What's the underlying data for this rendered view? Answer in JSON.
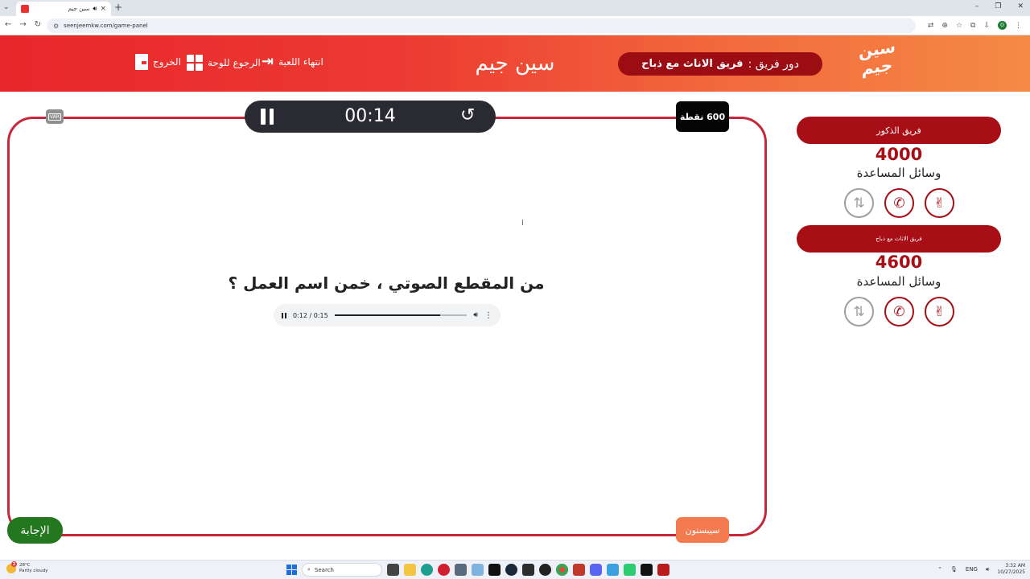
{
  "browser": {
    "tab_title": "سين جيم",
    "tab_audio_icon": "speaker-icon",
    "url": "seenjeemkw.com/game-panel"
  },
  "header": {
    "logo_text_line1": "سين",
    "logo_text_line2": "جيم",
    "turn_label": "دور فريق :",
    "turn_team": "فريق الاناث مع ذباح",
    "title": "سين جيم",
    "end_game": "انتهاء اللعبة",
    "back_to_board": "الرجوع للوحة",
    "exit": "الخروج"
  },
  "board": {
    "var_label": "VAR",
    "timer": "00:14",
    "points": "600 نقطة",
    "question": "من المقطع الصوتي ، خمن اسم العمل ؟",
    "audio": {
      "time": "0:12 / 0:15",
      "progress": 0.8
    },
    "answer_button": "الإجابة",
    "category_button": "سيبستون"
  },
  "teams": [
    {
      "name": "فريق الذكور",
      "score": "4000",
      "aids_label": "وسائل المساعدة"
    },
    {
      "name": "فريق الاناث مع ذباح",
      "score": "4600",
      "aids_label": "وسائل المساعدة"
    }
  ],
  "taskbar": {
    "weather_temp": "28°C",
    "weather_desc": "Partly cloudy",
    "weather_badge": "2",
    "search_placeholder": "Search",
    "lang": "ENG",
    "time": "3:32 AM",
    "date": "10/27/2025"
  },
  "colors": {
    "brand_red": "#a70e15",
    "header_gradient_start": "#e8262b",
    "header_gradient_end": "#f58a45",
    "answer_green": "#23781f",
    "category_orange": "#f47a50"
  }
}
